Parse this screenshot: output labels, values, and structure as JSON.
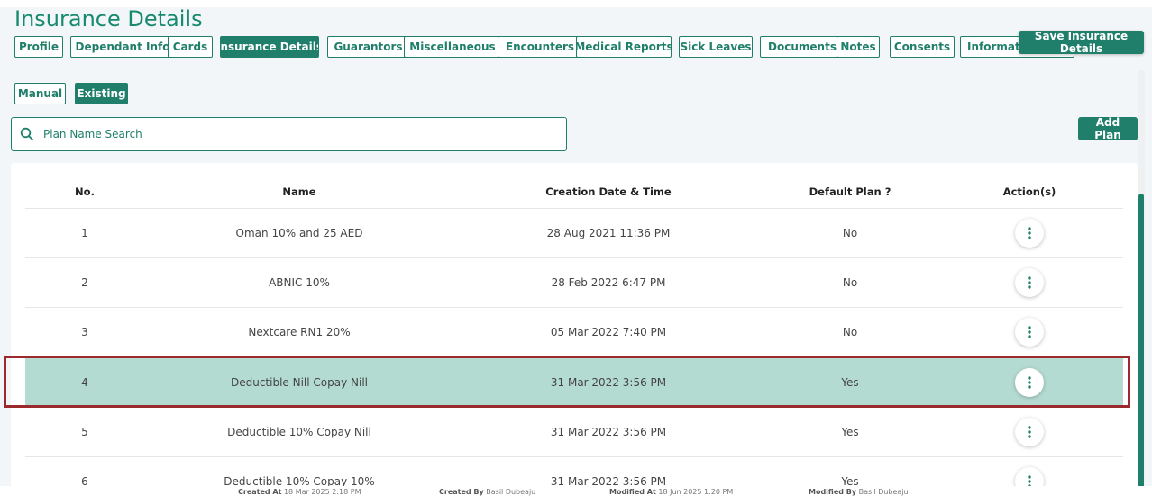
{
  "page": {
    "title": "Insurance Details"
  },
  "tabs": [
    {
      "label": "Profile"
    },
    {
      "label": "Dependant Info"
    },
    {
      "label": "Cards"
    },
    {
      "label": "Insurance Details",
      "active": true
    },
    {
      "label": "Guarantors"
    },
    {
      "label": "Miscellaneous"
    },
    {
      "label": "Encounters"
    },
    {
      "label": "Medical Reports"
    },
    {
      "label": "Sick Leaves"
    },
    {
      "label": "Documents"
    },
    {
      "label": "Notes"
    },
    {
      "label": "Consents"
    },
    {
      "label": "Informatio"
    }
  ],
  "toolbar": {
    "save_label": "Save Insurance Details",
    "add_plan_label": "Add Plan"
  },
  "subtabs": [
    {
      "label": "Manual"
    },
    {
      "label": "Existing",
      "active": true
    }
  ],
  "search": {
    "placeholder": "Plan Name Search",
    "icon": "search-icon"
  },
  "table": {
    "columns": [
      "No.",
      "Name",
      "Creation Date & Time",
      "Default Plan ?",
      "Action(s)"
    ],
    "rows": [
      {
        "no": "1",
        "name": "Oman 10% and 25 AED",
        "created": "28 Aug 2021 11:36 PM",
        "default": "No"
      },
      {
        "no": "2",
        "name": "ABNIC 10%",
        "created": "28 Feb 2022 6:47 PM",
        "default": "No"
      },
      {
        "no": "3",
        "name": "Nextcare RN1 20%",
        "created": "05 Mar 2022 7:40 PM",
        "default": "No"
      },
      {
        "no": "4",
        "name": "Deductible Nill Copay Nill",
        "created": "31 Mar 2022 3:56 PM",
        "default": "Yes",
        "selected": true
      },
      {
        "no": "5",
        "name": "Deductible 10% Copay Nill",
        "created": "31 Mar 2022 3:56 PM",
        "default": "Yes"
      },
      {
        "no": "6",
        "name": "Deductible 10% Copay 10%",
        "created": "31 Mar 2022 3:56 PM",
        "default": "Yes"
      }
    ]
  },
  "footer": {
    "created_at_label": "Created At",
    "created_at": "18 Mar 2025 2:18 PM",
    "created_by_label": "Created By",
    "created_by": "Basil Dubeaju",
    "modified_at_label": "Modified At",
    "modified_at": "18 Jun 2025 1:20 PM",
    "modified_by_label": "Modified By",
    "modified_by": "Basil Dubeaju"
  },
  "colors": {
    "accent": "#1f7f6a",
    "title": "#168a6f",
    "selected_row": "#b4dbd1",
    "highlight_border": "#9b2a2c"
  }
}
